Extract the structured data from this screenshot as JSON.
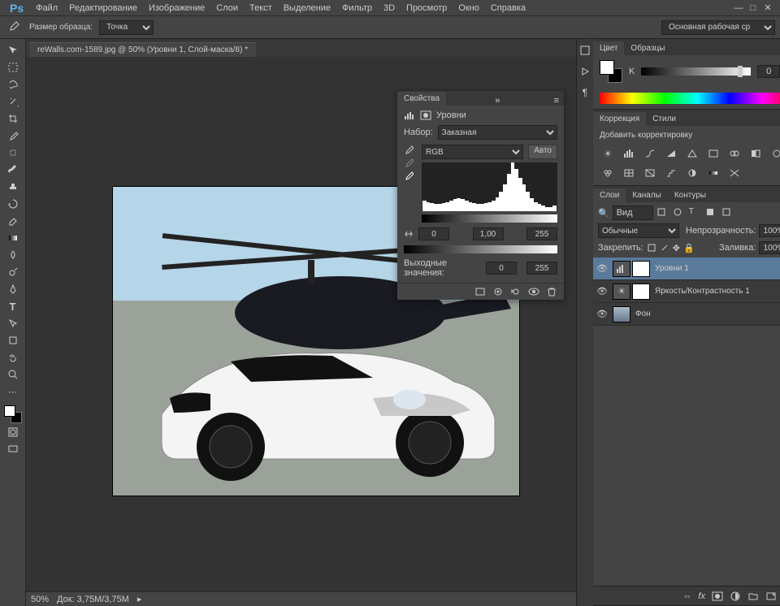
{
  "app": {
    "name": "Ps"
  },
  "menu": [
    "Файл",
    "Редактирование",
    "Изображение",
    "Слои",
    "Текст",
    "Выделение",
    "Фильтр",
    "3D",
    "Просмотр",
    "Окно",
    "Справка"
  ],
  "options": {
    "sample_label": "Размер образца:",
    "sample_value": "Точка",
    "workspace": "Основная рабочая среда"
  },
  "doc_tab": "reWalls.com-1589.jpg @ 50% (Уровни 1, Слой-маска/8) *",
  "status": {
    "zoom": "50%",
    "doc": "Док: 3,75M/3,75M"
  },
  "color_panel": {
    "tabs": [
      "Цвет",
      "Образцы"
    ],
    "active": 0,
    "channel": "K",
    "value": "0",
    "unit": "%"
  },
  "adjustments_panel": {
    "tabs": [
      "Коррекция",
      "Стили"
    ],
    "active": 0,
    "title": "Добавить корректировку"
  },
  "layers_panel": {
    "tabs": [
      "Слои",
      "Каналы",
      "Контуры"
    ],
    "active": 0,
    "kind_label": "Вид",
    "blend": "Обычные",
    "opacity_label": "Непрозрачность:",
    "opacity": "100%",
    "lock_label": "Закрепить:",
    "fill_label": "Заливка:",
    "fill": "100%",
    "layers": [
      {
        "name": "Уровни 1",
        "selected": true,
        "type": "levels"
      },
      {
        "name": "Яркость/Контрастность 1",
        "selected": false,
        "type": "brightness"
      },
      {
        "name": "Фон",
        "selected": false,
        "type": "image",
        "locked": true
      }
    ]
  },
  "properties_panel": {
    "title": "Свойства",
    "kind": "Уровни",
    "preset_label": "Набор:",
    "preset": "Заказная",
    "channel": "RGB",
    "auto": "Авто",
    "inputs": [
      "0",
      "1,00",
      "255"
    ],
    "output_label": "Выходные значения:",
    "outputs": [
      "0",
      "255"
    ],
    "histogram": [
      12,
      10,
      9,
      8,
      8,
      9,
      10,
      12,
      14,
      15,
      14,
      12,
      10,
      9,
      8,
      8,
      9,
      10,
      12,
      16,
      22,
      30,
      42,
      55,
      48,
      38,
      30,
      22,
      15,
      10,
      8,
      6,
      5,
      5,
      6
    ]
  }
}
